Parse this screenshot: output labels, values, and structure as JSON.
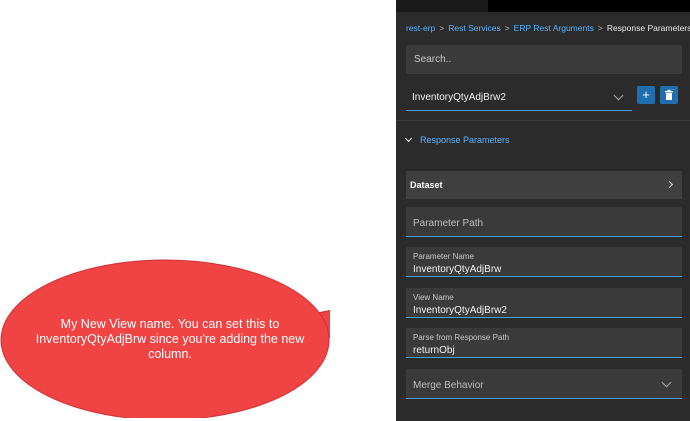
{
  "breadcrumb": {
    "items": [
      "rest-erp",
      "Rest Services",
      "ERP Rest Arguments"
    ],
    "separator": ">",
    "current": "Response Parameters"
  },
  "search": {
    "placeholder": "Search.."
  },
  "view_selector": {
    "selected": "InventoryQtyAdjBrw2"
  },
  "buttons": {
    "add_label": "+"
  },
  "section": {
    "label": "Response Parameters"
  },
  "dataset": {
    "label": "Dataset"
  },
  "fields": {
    "parameter_path": {
      "placeholder": "Parameter Path"
    },
    "parameter_name": {
      "label": "Parameter Name",
      "value": "InventoryQtyAdjBrw"
    },
    "view_name": {
      "label": "View Name",
      "value": "InventoryQtyAdjBrw2"
    },
    "parse_from": {
      "label": "Parse from Response Path",
      "value": "returnObj"
    },
    "merge_behavior": {
      "placeholder": "Merge Behavior"
    }
  },
  "callout": {
    "text": "My New View name. You can set this to InventoryQtyAdjBrw since you're adding the new column."
  },
  "colors": {
    "panel": "#2b2b2b",
    "field": "#3a3a3a",
    "accent": "#5ab4ff",
    "button": "#1f6fb0",
    "callout": "#f04343"
  },
  "icons": [
    "chevron-down-icon",
    "plus-icon",
    "trash-icon",
    "chevron-right-icon"
  ]
}
